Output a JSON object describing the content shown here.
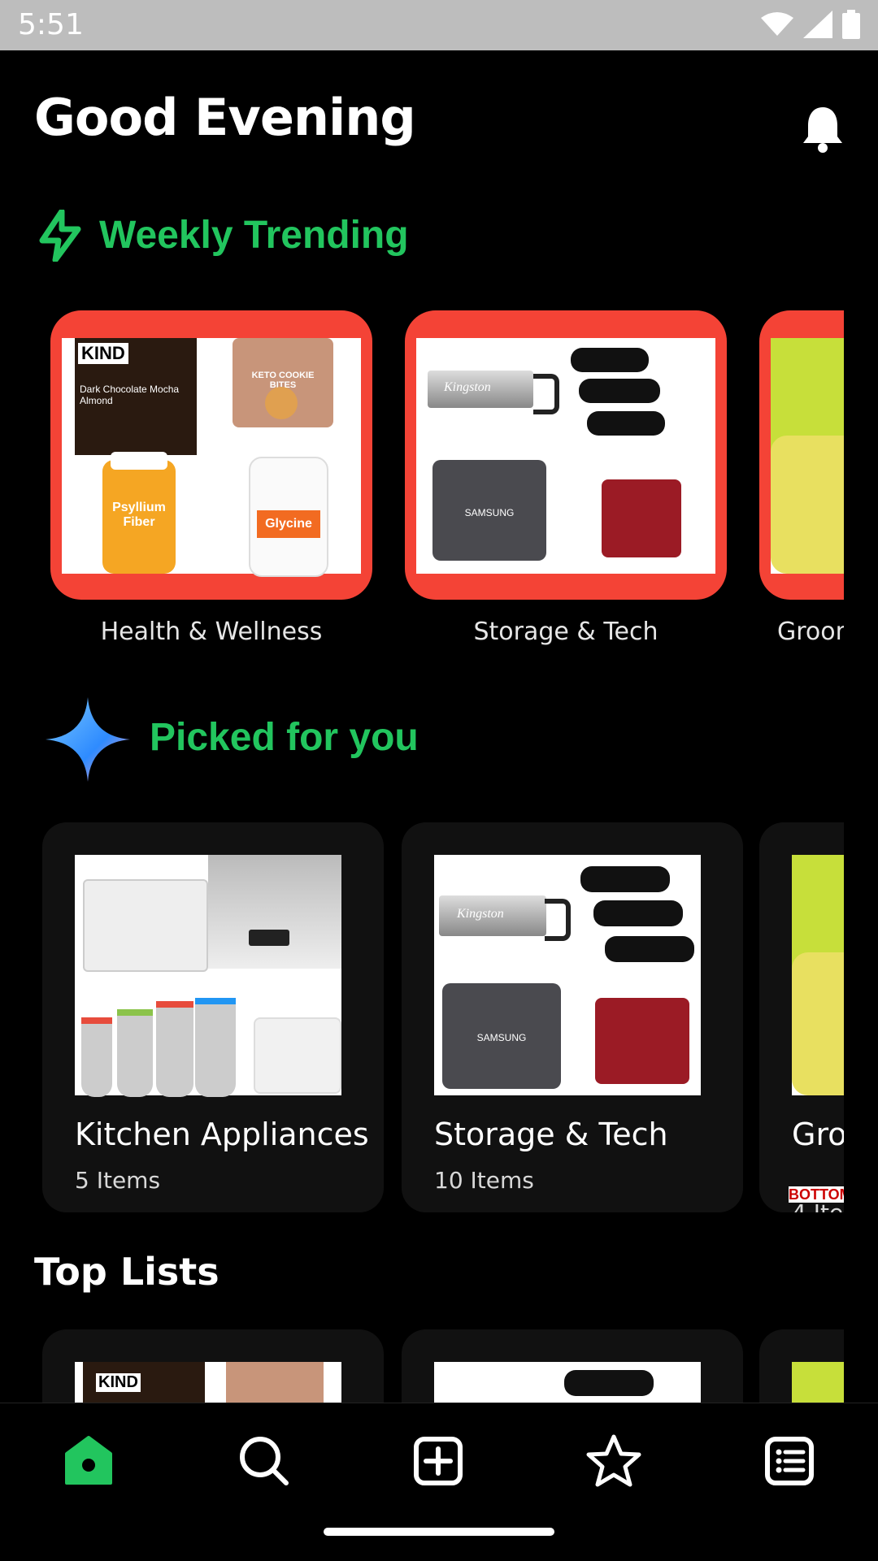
{
  "status_bar": {
    "time": "5:51"
  },
  "header": {
    "greeting": "Good Evening"
  },
  "weekly_trending": {
    "title": "Weekly Trending",
    "cards": [
      {
        "label": "Health & Wellness"
      },
      {
        "label": "Storage & Tech"
      },
      {
        "label": "Groom"
      }
    ]
  },
  "picked_for_you": {
    "title": "Picked for you",
    "cards": [
      {
        "title": "Kitchen Appliances",
        "count": "5 Items"
      },
      {
        "title": "Storage & Tech",
        "count": "10 Items"
      },
      {
        "title": "Gro",
        "count": "4 Ite"
      }
    ]
  },
  "top_lists": {
    "title": "Top Lists"
  },
  "product_texts": {
    "kind": "KIND",
    "kind_flavor": "Dark Chocolate Mocha Almond",
    "keto": "KETO COOKIE BITES",
    "psyllium": "Psyllium Fiber",
    "glycine": "Glycine",
    "kingston": "Kingston",
    "samsung": "SAMSUNG",
    "bottom": "BOTTOM"
  },
  "colors": {
    "accent_green": "#22c55e",
    "card_red": "#f44336"
  },
  "nav": {
    "items": [
      {
        "icon": "home-icon",
        "active": true
      },
      {
        "icon": "search-icon"
      },
      {
        "icon": "add-icon"
      },
      {
        "icon": "star-icon"
      },
      {
        "icon": "list-icon"
      }
    ]
  }
}
